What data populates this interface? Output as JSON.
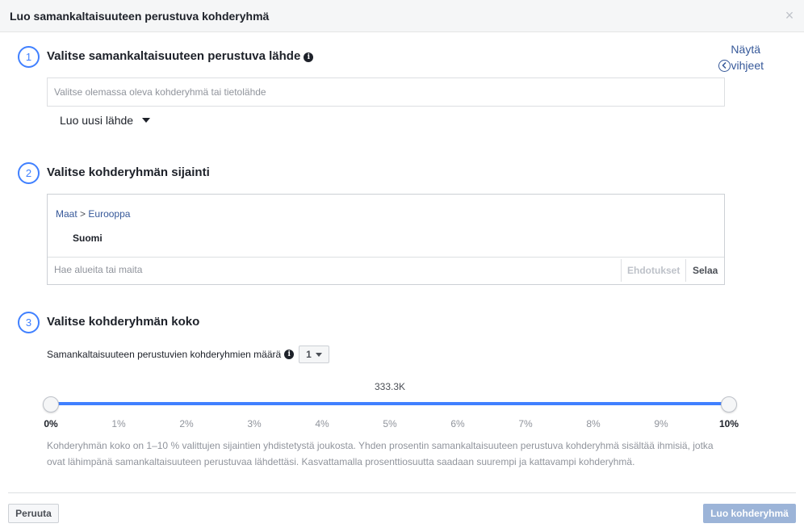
{
  "dialog": {
    "title": "Luo samankaltaisuuteen perustuva kohderyhmä",
    "close_glyph": "×"
  },
  "hints": {
    "line1": "Näytä",
    "line2": "vihjeet",
    "icon": "chevron-left-circle-icon"
  },
  "step1": {
    "number": "1",
    "title": "Valitse samankaltaisuuteen perustuva lähde",
    "info_glyph": "i",
    "source_placeholder": "Valitse olemassa oleva kohderyhmä tai tietolähde",
    "source_value": "",
    "new_source_label": "Luo uusi lähde"
  },
  "step2": {
    "number": "2",
    "title": "Valitse kohderyhmän sijainti",
    "breadcrumb_root": "Maat",
    "breadcrumb_sep": ">",
    "breadcrumb_leaf": "Eurooppa",
    "selected_location": "Suomi",
    "search_placeholder": "Hae alueita tai maita",
    "suggestions_label": "Ehdotukset",
    "browse_label": "Selaa"
  },
  "step3": {
    "number": "3",
    "title": "Valitse kohderyhmän koko",
    "count_label": "Samankaltaisuuteen perustuvien kohderyhmien määrä",
    "info_glyph": "i",
    "count_value": "1",
    "slider": {
      "value_label": "333.3K",
      "range_start_percent": 0,
      "range_end_percent": 10,
      "ticks": [
        "0%",
        "1%",
        "2%",
        "3%",
        "4%",
        "5%",
        "6%",
        "7%",
        "8%",
        "9%",
        "10%"
      ]
    },
    "description": "Kohderyhmän koko on 1–10 % valittujen sijaintien yhdistetystä joukosta. Yhden prosentin samankaltaisuuteen perustuva kohderyhmä sisältää ihmisiä, jotka ovat lähimpänä samankaltaisuuteen perustuvaa lähdettäsi. Kasvattamalla prosenttiosuutta saadaan suurempi ja kattavampi kohderyhmä."
  },
  "footer": {
    "cancel_label": "Peruuta",
    "create_label": "Luo kohderyhmä"
  },
  "colors": {
    "accent": "#4080ff",
    "link": "#365899",
    "disabled_button": "#9cb4d8"
  }
}
